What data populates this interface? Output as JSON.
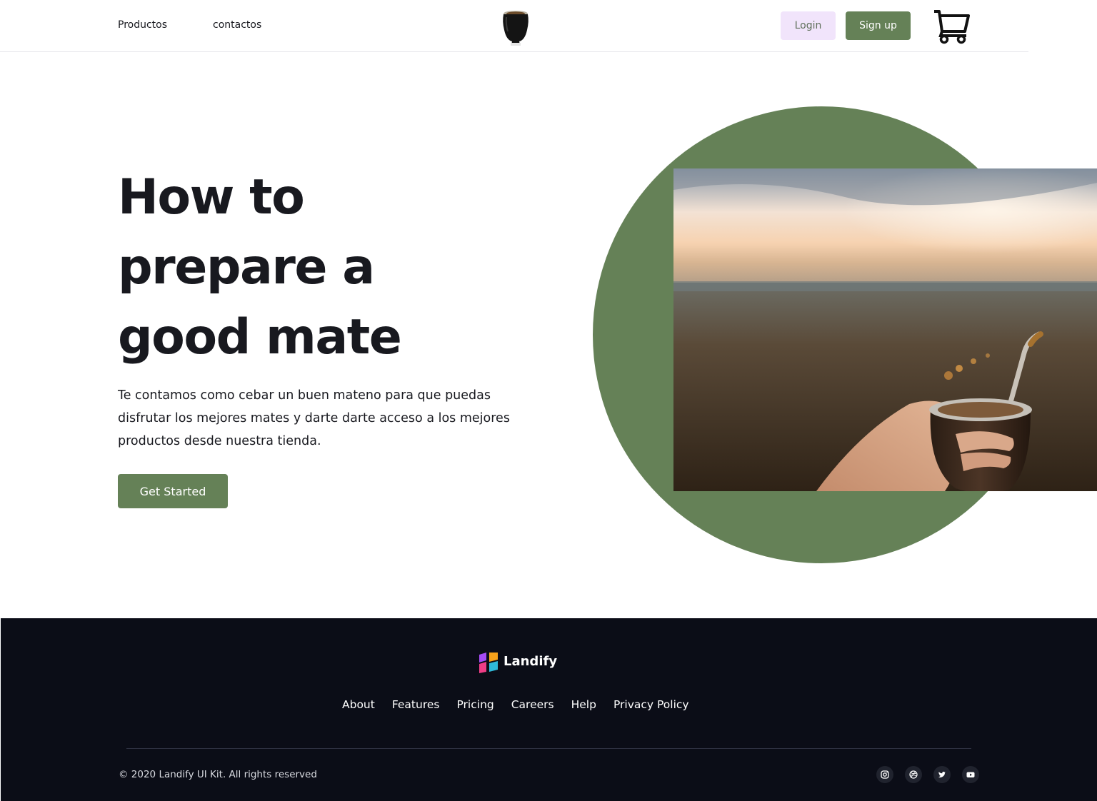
{
  "header": {
    "nav": [
      {
        "label": "Productos"
      },
      {
        "label": "contactos"
      }
    ],
    "logo_icon": "mate-cup-icon",
    "login_label": "Login",
    "signup_label": "Sign up",
    "cart_icon": "shopping-cart-icon"
  },
  "hero": {
    "title_lines": [
      "How to",
      "prepare a",
      "good mate"
    ],
    "description": "Te contamos como cebar un buen mateno para que puedas disfrutar los mejores mates y darte darte acceso a los mejores productos desde nuestra tienda.",
    "cta_label": "Get Started",
    "image_subject": "hand-holding-mate-at-sunset"
  },
  "footer": {
    "brand": "Landify",
    "links": [
      "About",
      "Features",
      "Pricing",
      "Careers",
      "Help",
      "Privacy Policy"
    ],
    "copyright": "© 2020 Landify UI Kit. All rights reserved",
    "social_icons": [
      "instagram-icon",
      "dribbble-icon",
      "twitter-icon",
      "youtube-icon"
    ]
  },
  "colors": {
    "accent_green": "#658157",
    "login_bg": "#f1e4fb",
    "footer_bg": "#0b0d17",
    "text_dark": "#18191f"
  }
}
